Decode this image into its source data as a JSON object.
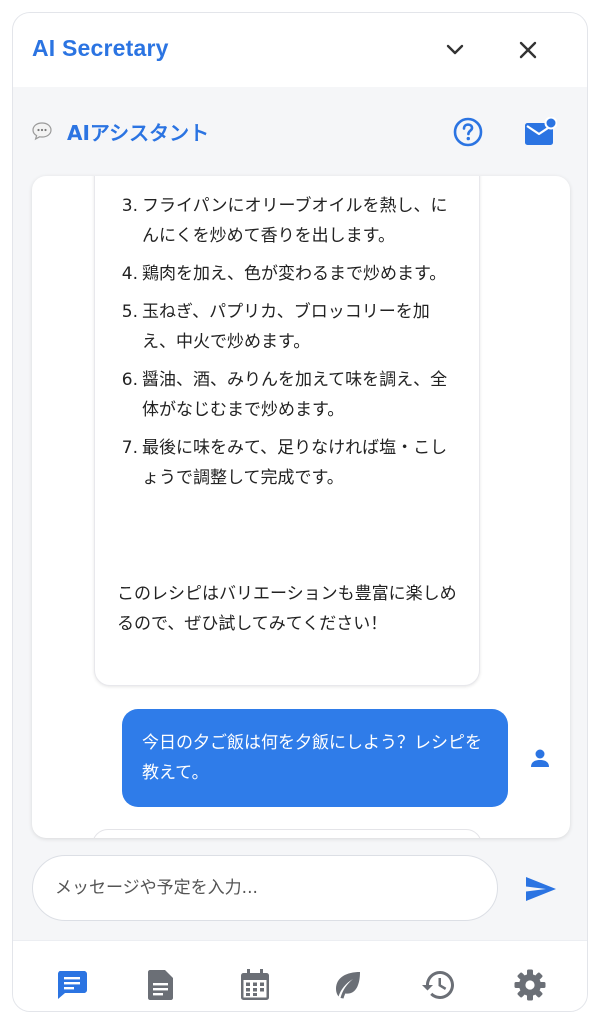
{
  "window": {
    "title": "AI Secretary"
  },
  "assistant": {
    "title": "AIアシスタント"
  },
  "messages": {
    "ai": {
      "steps": [
        {
          "num": "3.",
          "text": "フライパンにオリーブオイルを熱し、にんにくを炒めて香りを出します。"
        },
        {
          "num": "4.",
          "text": "鶏肉を加え、色が変わるまで炒めます。"
        },
        {
          "num": "5.",
          "text": "玉ねぎ、パプリカ、ブロッコリーを加え、中火で炒めます。"
        },
        {
          "num": "6.",
          "text": "醤油、酒、みりんを加えて味を調え、全体がなじむまで炒めます。"
        },
        {
          "num": "7.",
          "text": "最後に味をみて、足りなければ塩・こしょうで調整して完成です。"
        }
      ],
      "outro": "このレシピはバリエーションも豊富に楽しめるので、ぜひ試してみてください！"
    },
    "user": {
      "text": "今日の夕ご飯は何を夕飯にしよう？レシピを教えて。"
    }
  },
  "input": {
    "placeholder": "メッセージや予定を入力...",
    "value": ""
  },
  "colors": {
    "accent": "#2b74e2",
    "user_bubble": "#2f7ce9",
    "nav_icon": "#6b6f76"
  },
  "icons": {
    "minimize": "chevron-down-icon",
    "close": "close-icon",
    "chat": "speech-bubble-icon",
    "help": "help-circle-icon",
    "mail": "mail-notification-icon",
    "user": "person-icon",
    "send": "send-icon",
    "nav": [
      "chat-icon",
      "notes-icon",
      "calendar-icon",
      "leaf-icon",
      "history-icon",
      "settings-icon"
    ]
  }
}
